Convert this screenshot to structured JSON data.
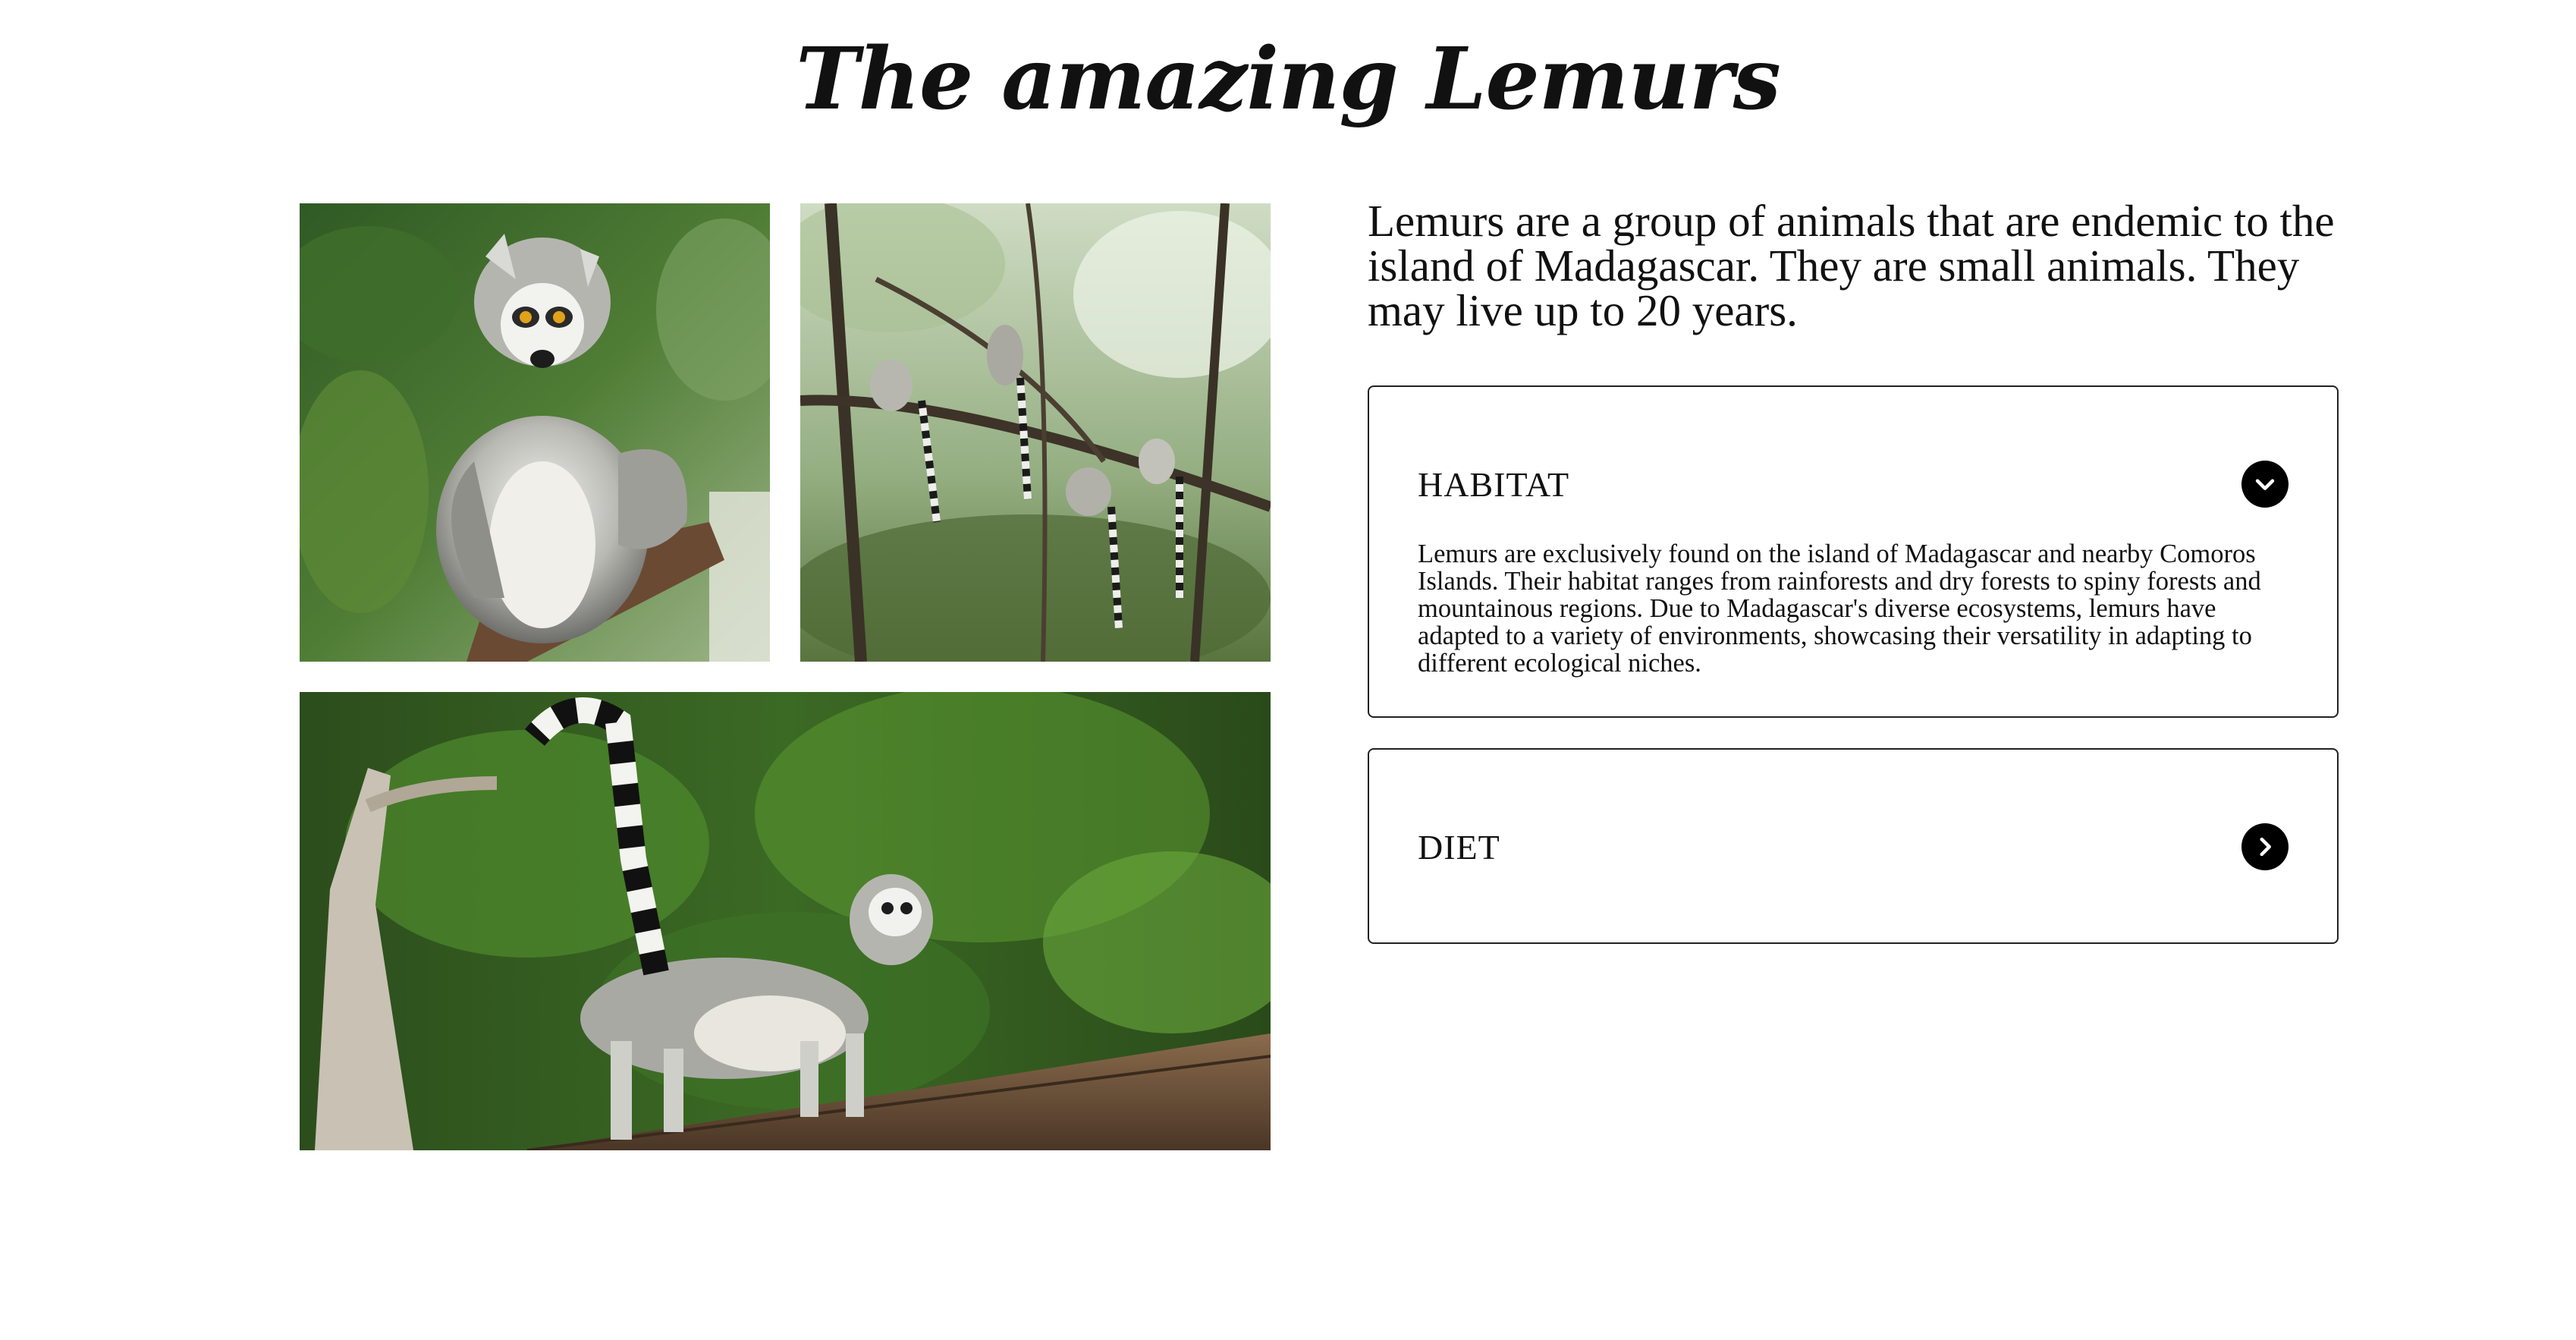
{
  "page": {
    "title": "The amazing Lemurs"
  },
  "gallery": {
    "images": [
      {
        "name": "lemur-sitting-photo"
      },
      {
        "name": "lemurs-in-trees-photo"
      },
      {
        "name": "lemur-walking-photo"
      }
    ]
  },
  "intro": {
    "text": "Lemurs are a group of animals that are endemic to the island of Madagascar. They are small animals. They may live up to 20 years."
  },
  "accordion": {
    "items": [
      {
        "title": "HABITAT",
        "expanded": true,
        "icon": "chevron-down-icon",
        "body": "Lemurs are exclusively found on the island of Madagascar and nearby Comoros Islands. Their habitat ranges from rainforests and dry forests to spiny forests and mountainous regions. Due to Madagascar's diverse ecosystems, lemurs have adapted to a variety of environments, showcasing their versatility in adapting to different ecological niches."
      },
      {
        "title": "DIET",
        "expanded": false,
        "icon": "chevron-right-icon"
      }
    ]
  },
  "colors": {
    "background": "#ffffff",
    "text": "#111111",
    "toggle": "#000000",
    "border": "#222222"
  }
}
